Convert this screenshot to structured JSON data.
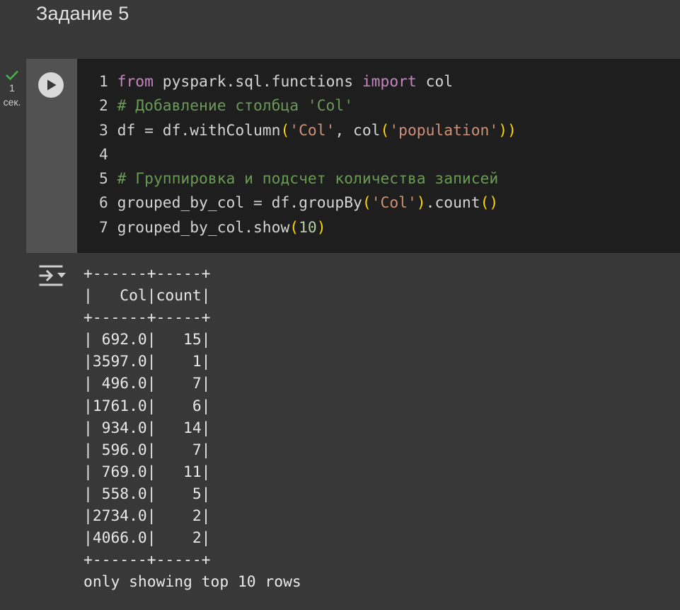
{
  "section": {
    "heading": "Задание 5"
  },
  "cell": {
    "status": {
      "duration_value": "1",
      "duration_unit": "сек."
    },
    "code_lines": [
      {
        "number": "1",
        "parts": [
          {
            "t": "from",
            "c": "kw"
          },
          {
            "t": " pyspark.sql.functions "
          },
          {
            "t": "import",
            "c": "kw"
          },
          {
            "t": " col"
          }
        ]
      },
      {
        "number": "2",
        "parts": [
          {
            "t": "# Добавление столбца 'Col'",
            "c": "cm"
          }
        ]
      },
      {
        "number": "3",
        "parts": [
          {
            "t": "df = df.withColumn"
          },
          {
            "t": "(",
            "c": "br"
          },
          {
            "t": "'Col'",
            "c": "st"
          },
          {
            "t": ", col"
          },
          {
            "t": "(",
            "c": "br"
          },
          {
            "t": "'population'",
            "c": "st"
          },
          {
            "t": "))",
            "c": "br"
          }
        ]
      },
      {
        "number": "4",
        "parts": []
      },
      {
        "number": "5",
        "parts": [
          {
            "t": "# Группировка и подсчет количества записей",
            "c": "cm"
          }
        ]
      },
      {
        "number": "6",
        "parts": [
          {
            "t": "grouped_by_col = df.groupBy"
          },
          {
            "t": "(",
            "c": "br"
          },
          {
            "t": "'Col'",
            "c": "st"
          },
          {
            "t": ")",
            "c": "br"
          },
          {
            "t": ".count"
          },
          {
            "t": "()",
            "c": "br"
          }
        ]
      },
      {
        "number": "7",
        "parts": [
          {
            "t": "grouped_by_col.show"
          },
          {
            "t": "(",
            "c": "br"
          },
          {
            "t": "10",
            "c": "nm"
          },
          {
            "t": ")",
            "c": "br"
          }
        ]
      }
    ],
    "output": {
      "border": "+------+-----+",
      "header": "|   Col|count|",
      "rows": [
        "| 692.0|   15|",
        "|3597.0|    1|",
        "| 496.0|    7|",
        "|1761.0|    6|",
        "| 934.0|   14|",
        "| 596.0|    7|",
        "| 769.0|   11|",
        "| 558.0|    5|",
        "|2734.0|    2|",
        "|4066.0|    2|"
      ],
      "footer": "only showing top 10 rows"
    }
  },
  "icons": {
    "status": "check-icon",
    "run": "play-icon",
    "output": "output-toggle-icon"
  },
  "colors": {
    "page_bg": "#383838",
    "editor_bg": "#1e1e1e",
    "gutter_bg": "#525252",
    "check": "#4caf50",
    "keyword": "#c586c0",
    "comment": "#6a9955",
    "string": "#ce9178",
    "bracket": "#ffd700",
    "number": "#b5cea8"
  }
}
